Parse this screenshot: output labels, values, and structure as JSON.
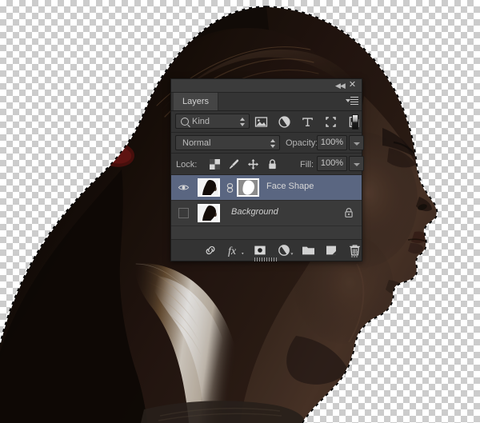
{
  "app": {
    "panel_title": "Layers",
    "titlebar": {
      "collapse_icon": "collapse-arrows-icon",
      "close_icon": "close-icon",
      "menu_icon": "panel-menu-icon"
    }
  },
  "filter_bar": {
    "kind_label": "Kind",
    "search_icon": "search-icon",
    "icons": [
      {
        "name": "filter-pixel-icon",
        "label": "Pixel Layers"
      },
      {
        "name": "filter-adjustment-icon",
        "label": "Adjustment Layers"
      },
      {
        "name": "filter-type-icon",
        "label": "Type Layers"
      },
      {
        "name": "filter-shape-icon",
        "label": "Shape Layers"
      },
      {
        "name": "filter-smart-object-icon",
        "label": "Smart Objects"
      }
    ],
    "toggle_name": "filter-enable-toggle"
  },
  "blend_bar": {
    "blend_mode": "Normal",
    "opacity_label": "Opacity:",
    "opacity_value": "100%"
  },
  "lock_bar": {
    "lock_label": "Lock:",
    "fill_label": "Fill:",
    "fill_value": "100%",
    "icons": [
      {
        "name": "lock-transparency-icon",
        "label": "Lock Transparent Pixels"
      },
      {
        "name": "lock-image-brush-icon",
        "label": "Lock Image Pixels"
      },
      {
        "name": "lock-position-move-icon",
        "label": "Lock Position"
      },
      {
        "name": "lock-all-padlock-icon",
        "label": "Lock All"
      }
    ]
  },
  "layers": [
    {
      "name": "Face Shape",
      "visible": true,
      "selected": true,
      "italic": false,
      "has_mask": true,
      "locked": false,
      "link_icon": "link-chain-icon",
      "visibility_icon": "eye-icon",
      "thumb_name": "layer-thumbnail",
      "mask_name": "layer-mask-thumbnail"
    },
    {
      "name": "Background",
      "visible": false,
      "selected": false,
      "italic": true,
      "has_mask": false,
      "locked": true,
      "lock_icon": "padlock-icon",
      "visibility_icon": "eye-hidden-checkbox",
      "thumb_name": "layer-thumbnail"
    }
  ],
  "bottom_toolbar": [
    {
      "name": "link-layers-button",
      "label": "Link layers"
    },
    {
      "name": "layer-style-fx-button",
      "label": "Add a layer style"
    },
    {
      "name": "add-layer-mask-button",
      "label": "Add layer mask"
    },
    {
      "name": "new-adjustment-layer-button",
      "label": "New fill or adjustment layer"
    },
    {
      "name": "new-group-button",
      "label": "Create a new group"
    },
    {
      "name": "new-layer-button",
      "label": "Create a new layer"
    },
    {
      "name": "delete-layer-button",
      "label": "Delete layer"
    }
  ],
  "colors": {
    "panel_bg": "#2b2b2b",
    "row_bg": "#333333",
    "list_bg": "#3a3a3a",
    "selected_row": "#5a6681",
    "text": "#bdbdbd",
    "field_bg": "#3c3c3c",
    "checker_light": "#ffffff",
    "checker_dark": "#cccccc",
    "hair_tie": "#5c1414",
    "skin_shadow": "#3a2a22"
  },
  "canvas": {
    "subject": "woman-head-profile-silhouette",
    "selection": "marching-ants-selection",
    "transparency": "checkerboard"
  }
}
